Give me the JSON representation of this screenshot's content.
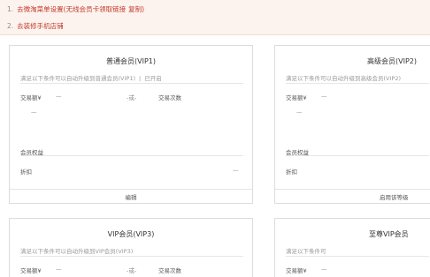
{
  "notice": {
    "line1_num": "1.",
    "line1_link": "去微淘菜单设置(无线会员卡领取链接",
    "line1_copy": "复制",
    "line1_close": ")",
    "line2_num": "2.",
    "line2_link": "去装修手机店铺"
  },
  "cards": [
    {
      "title": "普通会员(VIP1)",
      "condition": "满足以下条件可以自动升级到普通会员(VIP1)",
      "condition_sep": "|",
      "status": "已开启",
      "amount_label": "交易额¥",
      "amount_value": "—",
      "or_label": "-或-",
      "count_label": "交易次数",
      "count_value": "—",
      "benefit_label": "会员权益",
      "discount_label": "折扣",
      "discount_value": "—",
      "action": "编辑"
    },
    {
      "title": "高级会员(VIP2)",
      "condition": "满足以下条件可以自动升级到高级会员(VIP2)",
      "amount_label": "交易额¥",
      "amount_value": "—",
      "count_value": "—",
      "benefit_label": "会员权益",
      "discount_label": "折扣",
      "action": "启用该等级"
    },
    {
      "title": "VIP会员(VIP3)",
      "condition": "满足以下条件可以自动升级到VIP会员(VIP3)",
      "amount_label": "交易额¥",
      "amount_value": "—",
      "or_label": "-或-",
      "count_label": "交易次数"
    },
    {
      "title": "至尊VIP会员",
      "condition": "满足以下条件可",
      "amount_label": "交易额¥",
      "amount_value": "—"
    }
  ]
}
